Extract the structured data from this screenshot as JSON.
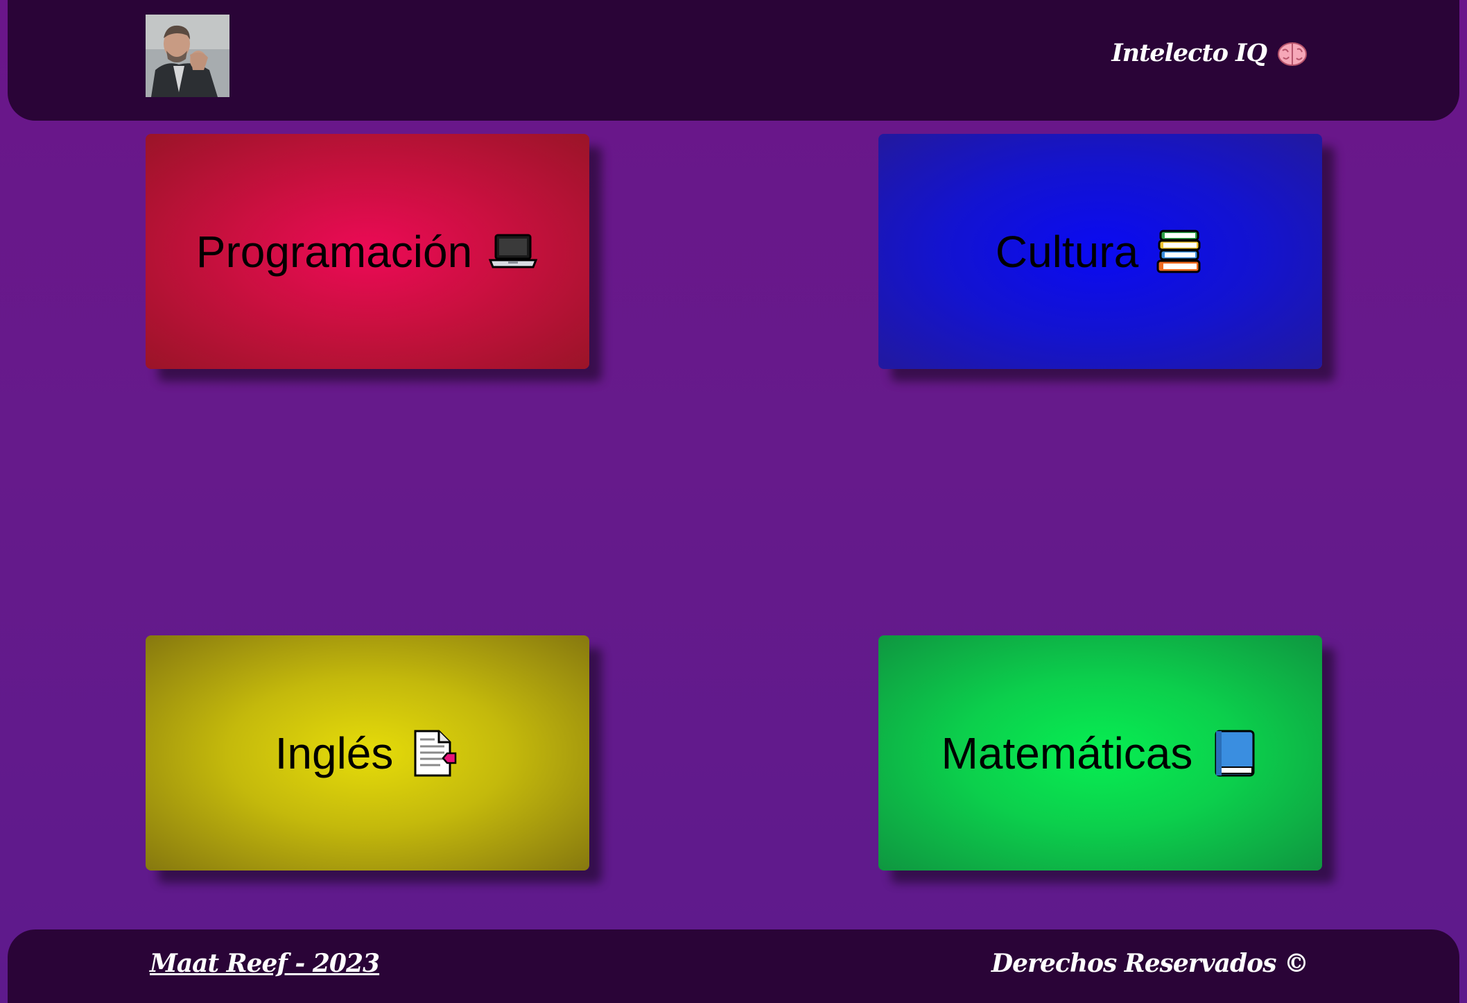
{
  "header": {
    "avatar_alt": "profile photo",
    "brand_title": "Intelecto IQ",
    "brand_icon": "brain-icon"
  },
  "cards": [
    {
      "label": "Programación",
      "icon": "laptop-icon",
      "color": "#ec0a56"
    },
    {
      "label": "Cultura",
      "icon": "books-icon",
      "color": "#0a0af2"
    },
    {
      "label": "Inglés",
      "icon": "document-icon",
      "color": "#e6dc0a"
    },
    {
      "label": "Matemáticas",
      "icon": "blue-book-icon",
      "color": "#07ee52"
    }
  ],
  "footer": {
    "author_link": "Maat Reef - 2023",
    "rights": "Derechos Reservados ©"
  },
  "colors": {
    "background": "#6a168a",
    "bars": "#2a0437"
  }
}
